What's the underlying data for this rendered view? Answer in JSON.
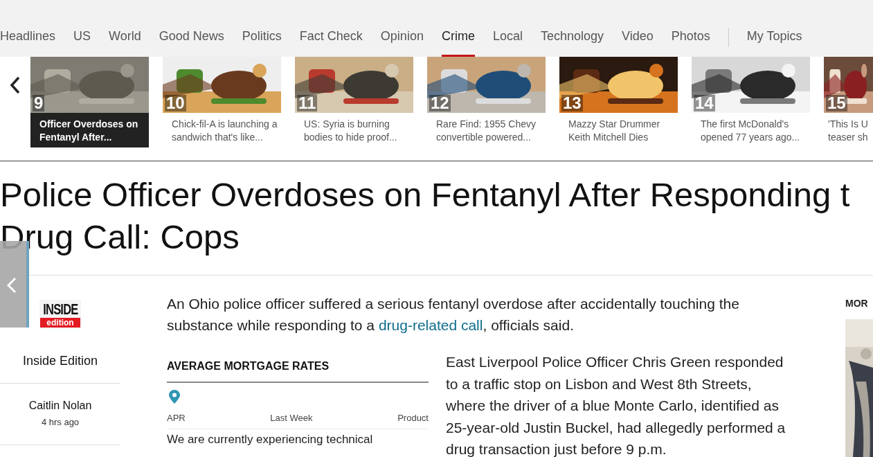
{
  "nav": {
    "tabs": [
      {
        "label": "Headlines",
        "selected": false
      },
      {
        "label": "US",
        "selected": false
      },
      {
        "label": "World",
        "selected": false
      },
      {
        "label": "Good News",
        "selected": false
      },
      {
        "label": "Politics",
        "selected": false
      },
      {
        "label": "Fact Check",
        "selected": false
      },
      {
        "label": "Opinion",
        "selected": false
      },
      {
        "label": "Crime",
        "selected": true
      },
      {
        "label": "Local",
        "selected": false
      },
      {
        "label": "Technology",
        "selected": false
      },
      {
        "label": "Video",
        "selected": false
      },
      {
        "label": "Photos",
        "selected": false
      }
    ],
    "my_topics": "My Topics"
  },
  "carousel": {
    "items": [
      {
        "number": "9",
        "caption": "Officer Overdoses on Fentanyl After...",
        "selected": true
      },
      {
        "number": "10",
        "caption": "Chick-fil-A is launching a sandwich that's like...",
        "selected": false
      },
      {
        "number": "11",
        "caption": "US: Syria is burning bodies to hide proof...",
        "selected": false
      },
      {
        "number": "12",
        "caption": "Rare Find: 1955 Chevy convertible powered...",
        "selected": false
      },
      {
        "number": "13",
        "caption": "Mazzy Star Drummer Keith Mitchell Dies",
        "selected": false
      },
      {
        "number": "14",
        "caption": "The first McDonald's opened 77 years ago...",
        "selected": false
      },
      {
        "number": "15",
        "caption": "'This Is U teaser sh",
        "selected": false
      }
    ]
  },
  "article": {
    "headline_lines": [
      "Police Officer Overdoses on Fentanyl After Responding t",
      "Drug Call: Cops"
    ],
    "source": {
      "logo_top": "INSIDE",
      "logo_bottom": "edition",
      "name": "Inside Edition"
    },
    "author": "Caitlin Nolan",
    "time": "4 hrs ago",
    "lead_before": "An Ohio police officer suffered a serious fentanyl overdose after accidentally touching the substance while responding to a ",
    "lead_link": "drug-related call",
    "lead_after": ", officials said.",
    "body": "East Liverpool Police Officer Chris Green responded to a traffic stop on Lisbon and West 8th Streets, where the driver of a blue Monte Carlo, identified as 25-year-old Justin Buckel, had allegedly performed a drug transaction just before 9 p.m."
  },
  "mortgage_widget": {
    "title": "AVERAGE MORTGAGE RATES",
    "columns": [
      "APR",
      "Last Week",
      "Product"
    ],
    "message": "We are currently experiencing technical"
  },
  "right_rail": {
    "heading": "MOR"
  }
}
